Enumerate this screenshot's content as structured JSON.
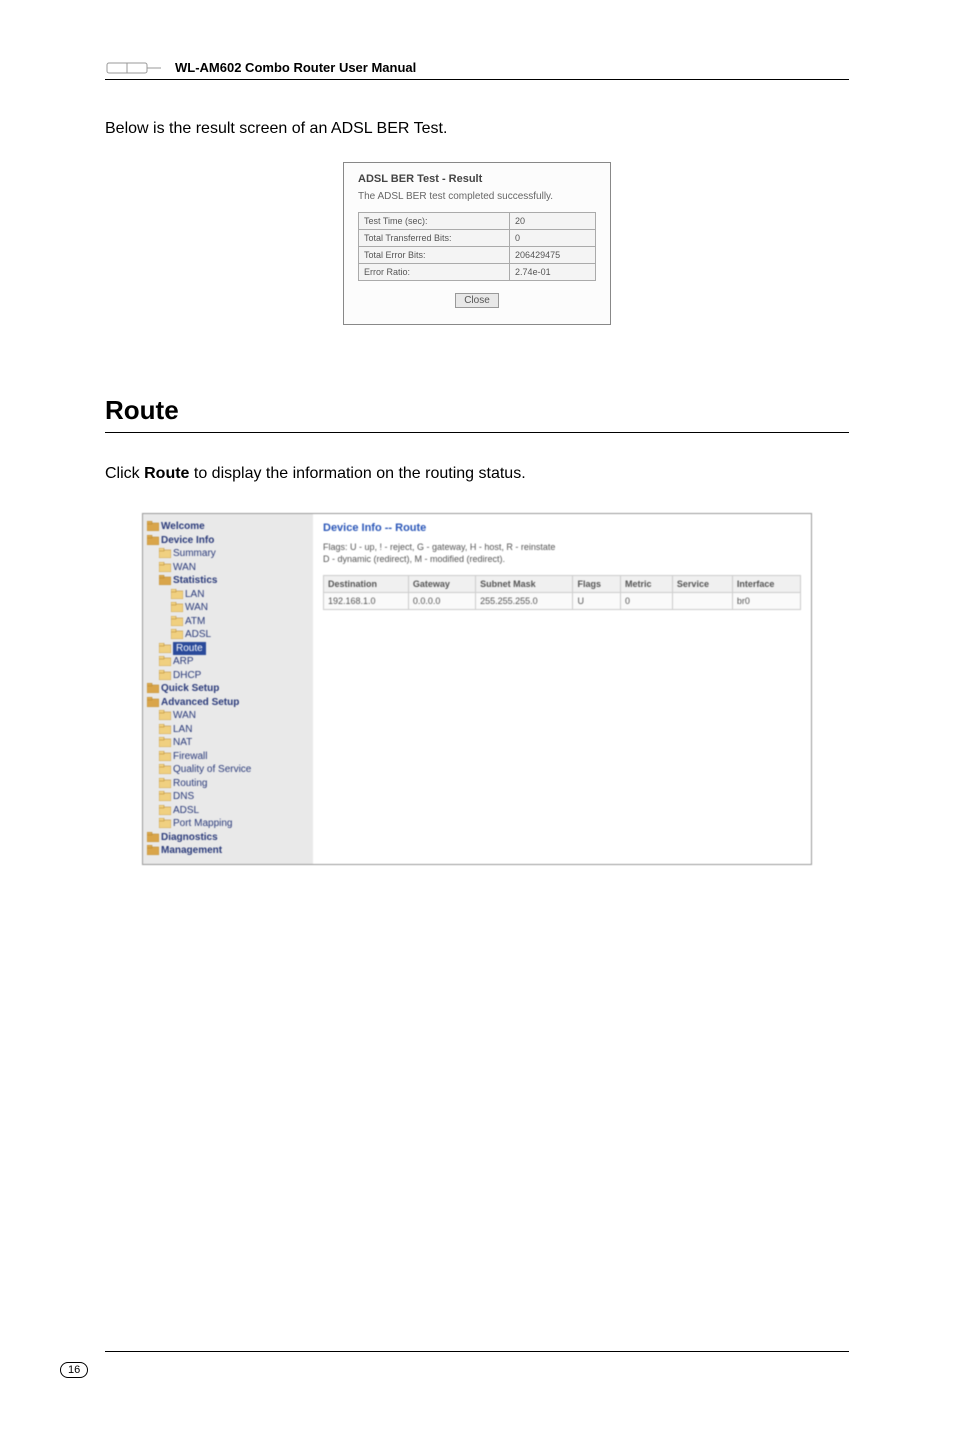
{
  "header": {
    "title": "WL-AM602 Combo Router User Manual"
  },
  "intro_text": "Below is the result screen of an ADSL BER Test.",
  "ber_dialog": {
    "title": "ADSL BER Test - Result",
    "message": "The ADSL BER test completed successfully.",
    "rows": [
      {
        "label": "Test Time (sec):",
        "value": "20"
      },
      {
        "label": "Total Transferred Bits:",
        "value": "0"
      },
      {
        "label": "Total Error Bits:",
        "value": "206429475"
      },
      {
        "label": "Error Ratio:",
        "value": "2.74e-01"
      }
    ],
    "close_label": "Close"
  },
  "section_title": "Route",
  "route_text_prefix": "Click ",
  "route_text_bold": "Route",
  "route_text_suffix": " to display the information on the routing status.",
  "route_panel": {
    "sidebar": {
      "items": [
        {
          "label": "Welcome",
          "indent": 0,
          "bold": true
        },
        {
          "label": "Device Info",
          "indent": 0,
          "bold": true
        },
        {
          "label": "Summary",
          "indent": 1
        },
        {
          "label": "WAN",
          "indent": 1
        },
        {
          "label": "Statistics",
          "indent": 1,
          "bold": true
        },
        {
          "label": "LAN",
          "indent": 2
        },
        {
          "label": "WAN",
          "indent": 2
        },
        {
          "label": "ATM",
          "indent": 2
        },
        {
          "label": "ADSL",
          "indent": 2
        },
        {
          "label": "Route",
          "indent": 1,
          "selected": true
        },
        {
          "label": "ARP",
          "indent": 1
        },
        {
          "label": "DHCP",
          "indent": 1
        },
        {
          "label": "Quick Setup",
          "indent": 0,
          "bold": true
        },
        {
          "label": "Advanced Setup",
          "indent": 0,
          "bold": true
        },
        {
          "label": "WAN",
          "indent": 1
        },
        {
          "label": "LAN",
          "indent": 1
        },
        {
          "label": "NAT",
          "indent": 1
        },
        {
          "label": "Firewall",
          "indent": 1
        },
        {
          "label": "Quality of Service",
          "indent": 1
        },
        {
          "label": "Routing",
          "indent": 1
        },
        {
          "label": "DNS",
          "indent": 1
        },
        {
          "label": "ADSL",
          "indent": 1
        },
        {
          "label": "Port Mapping",
          "indent": 1
        },
        {
          "label": "Diagnostics",
          "indent": 0,
          "bold": true
        },
        {
          "label": "Management",
          "indent": 0,
          "bold": true
        }
      ]
    },
    "main": {
      "title": "Device Info -- Route",
      "flags_line1": "Flags: U - up, ! - reject, G - gateway, H - host, R - reinstate",
      "flags_line2": "D - dynamic (redirect), M - modified (redirect).",
      "headers": [
        "Destination",
        "Gateway",
        "Subnet Mask",
        "Flags",
        "Metric",
        "Service",
        "Interface"
      ],
      "row": [
        "192.168.1.0",
        "0.0.0.0",
        "255.255.255.0",
        "U",
        "0",
        "",
        "br0"
      ]
    }
  },
  "page_number": "16"
}
